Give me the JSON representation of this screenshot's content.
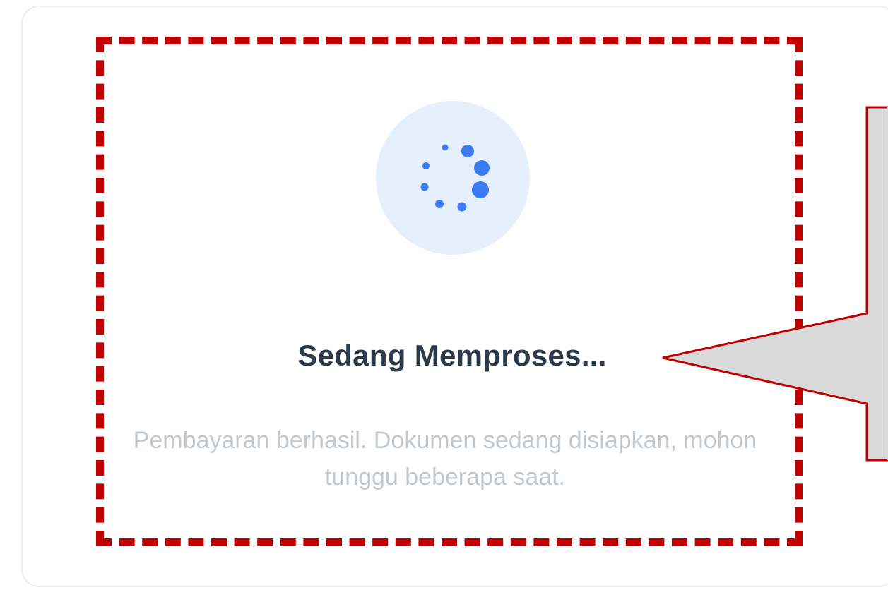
{
  "status": {
    "title": "Sedang Memproses...",
    "description": "Pembayaran berhasil. Dokumen sedang disiapkan, mohon tunggu beberapa saat."
  },
  "spinner": {
    "icon": "loading-spinner-icon",
    "color": "#3b7cf5",
    "background": "#e6f0fd"
  },
  "annotation": {
    "highlight_color": "#c00000",
    "callout_fill": "#d9d9d9",
    "callout_border": "#c00000"
  }
}
